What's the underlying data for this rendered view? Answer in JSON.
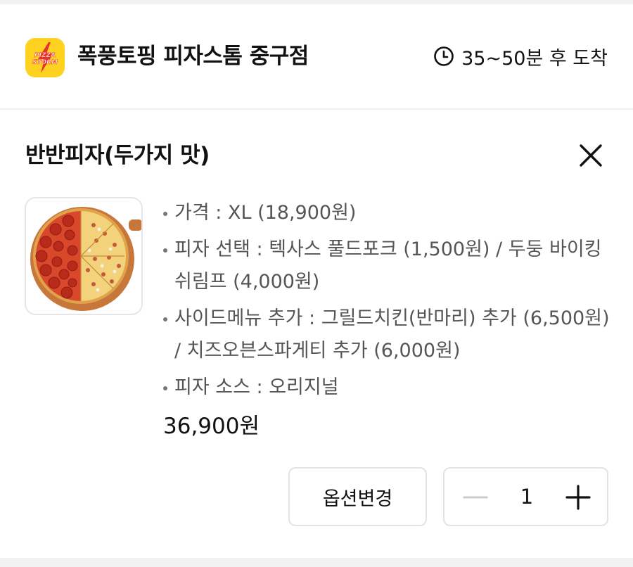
{
  "store": {
    "name": "폭풍토핑 피자스톰 중구점",
    "logo_text_line1": "PIZZA",
    "logo_text_line2": "STORM",
    "eta": "35~50분 후 도착"
  },
  "item": {
    "title": "반반피자(두가지 맛)",
    "image_icon": "pizza-image",
    "options": [
      "가격 : XL (18,900원)",
      "피자 선택 : 텍사스 풀드포크 (1,500원) / 두둥 바이킹쉬림프 (4,000원)",
      "사이드메뉴 추가 : 그릴드치킨(반마리) 추가 (6,500원) / 치즈오븐스파게티 추가 (6,000원)",
      "피자 소스 : 오리지널"
    ],
    "total_price": "36,900원"
  },
  "actions": {
    "change_option_label": "옵션변경",
    "quantity": "1"
  },
  "icons": {
    "clock": "clock-icon",
    "close": "close-icon",
    "minus": "minus-icon",
    "plus": "plus-icon"
  },
  "colors": {
    "brand_yellow": "#ffd21f",
    "brand_red": "#e8332a",
    "disabled_gray": "#cccccc",
    "option_text": "#555555"
  }
}
